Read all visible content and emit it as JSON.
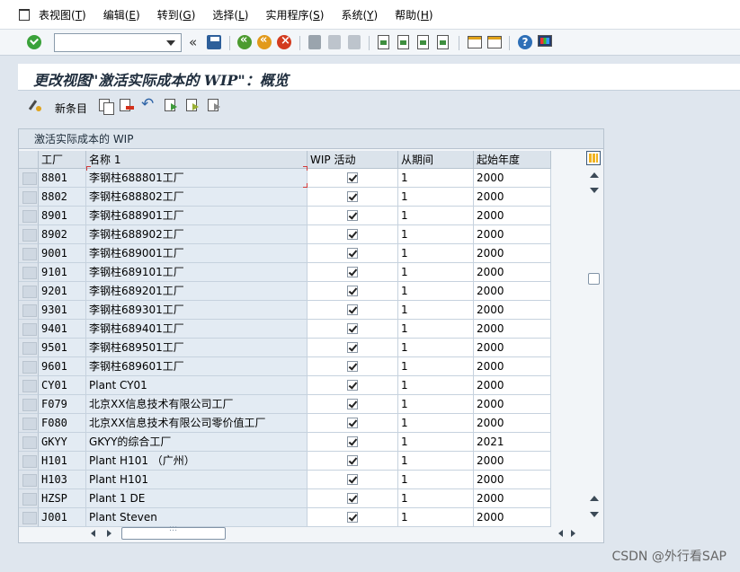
{
  "menu": {
    "items": [
      {
        "label": "表视图(",
        "key": "T",
        "suffix": ")"
      },
      {
        "label": "编辑(",
        "key": "E",
        "suffix": ")"
      },
      {
        "label": "转到(",
        "key": "G",
        "suffix": ")"
      },
      {
        "label": "选择(",
        "key": "L",
        "suffix": ")"
      },
      {
        "label": "实用程序(",
        "key": "S",
        "suffix": ")"
      },
      {
        "label": "系统(",
        "key": "Y",
        "suffix": ")"
      },
      {
        "label": "帮助(",
        "key": "H",
        "suffix": ")"
      }
    ]
  },
  "toolbar": {
    "command_value": "",
    "collapse_glyph": "«",
    "help_glyph": "?"
  },
  "page": {
    "title": "更改视图\"激活实际成本的 WIP\"：概览"
  },
  "app_toolbar": {
    "new_entries_label": "新条目"
  },
  "table": {
    "panel_title": "激活实际成本的 WIP",
    "columns": [
      "工厂",
      "名称 1",
      "WIP 活动",
      "从期间",
      "起始年度"
    ],
    "rows": [
      {
        "plant": "8801",
        "name": "李钢柱688801工厂",
        "wip": true,
        "from_period": "1",
        "start_year": "2000"
      },
      {
        "plant": "8802",
        "name": "李钢柱688802工厂",
        "wip": true,
        "from_period": "1",
        "start_year": "2000"
      },
      {
        "plant": "8901",
        "name": "李钢柱688901工厂",
        "wip": true,
        "from_period": "1",
        "start_year": "2000"
      },
      {
        "plant": "8902",
        "name": "李钢柱688902工厂",
        "wip": true,
        "from_period": "1",
        "start_year": "2000"
      },
      {
        "plant": "9001",
        "name": "李钢柱689001工厂",
        "wip": true,
        "from_period": "1",
        "start_year": "2000"
      },
      {
        "plant": "9101",
        "name": "李钢柱689101工厂",
        "wip": true,
        "from_period": "1",
        "start_year": "2000"
      },
      {
        "plant": "9201",
        "name": "李钢柱689201工厂",
        "wip": true,
        "from_period": "1",
        "start_year": "2000"
      },
      {
        "plant": "9301",
        "name": "李钢柱689301工厂",
        "wip": true,
        "from_period": "1",
        "start_year": "2000"
      },
      {
        "plant": "9401",
        "name": "李钢柱689401工厂",
        "wip": true,
        "from_period": "1",
        "start_year": "2000"
      },
      {
        "plant": "9501",
        "name": "李钢柱689501工厂",
        "wip": true,
        "from_period": "1",
        "start_year": "2000"
      },
      {
        "plant": "9601",
        "name": "李钢柱689601工厂",
        "wip": true,
        "from_period": "1",
        "start_year": "2000"
      },
      {
        "plant": "CY01",
        "name": "Plant CY01",
        "wip": true,
        "from_period": "1",
        "start_year": "2000"
      },
      {
        "plant": "F079",
        "name": "北京XX信息技术有限公司工厂",
        "wip": true,
        "from_period": "1",
        "start_year": "2000"
      },
      {
        "plant": "F080",
        "name": "北京XX信息技术有限公司零价值工厂",
        "wip": true,
        "from_period": "1",
        "start_year": "2000"
      },
      {
        "plant": "GKYY",
        "name": "GKYY的综合工厂",
        "wip": true,
        "from_period": "1",
        "start_year": "2021"
      },
      {
        "plant": "H101",
        "name": "Plant H101 （广州）",
        "wip": true,
        "from_period": "1",
        "start_year": "2000"
      },
      {
        "plant": "H103",
        "name": "Plant H101",
        "wip": true,
        "from_period": "1",
        "start_year": "2000"
      },
      {
        "plant": "HZSP",
        "name": "Plant 1 DE",
        "wip": true,
        "from_period": "1",
        "start_year": "2000"
      },
      {
        "plant": "J001",
        "name": "Plant Steven",
        "wip": true,
        "from_period": "1",
        "start_year": "2000"
      }
    ]
  },
  "watermark": "CSDN @外行看SAP"
}
